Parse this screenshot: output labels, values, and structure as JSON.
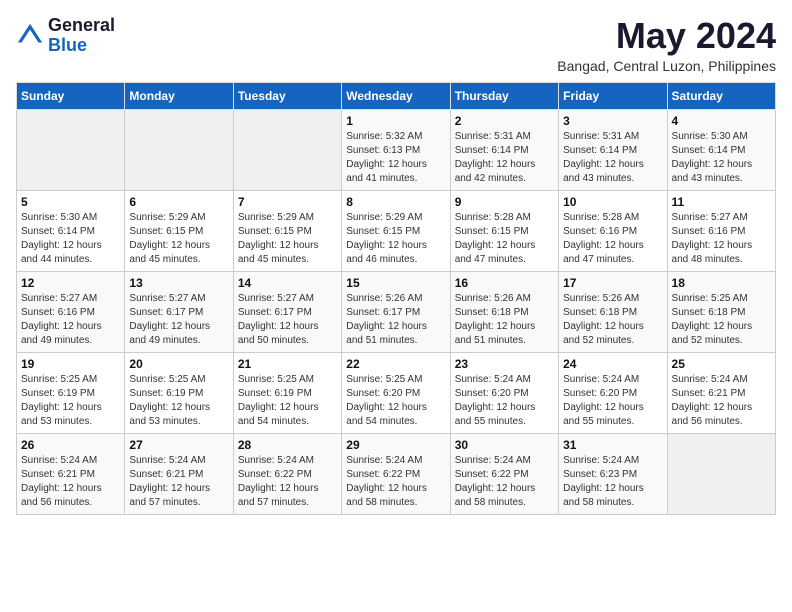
{
  "header": {
    "logo_general": "General",
    "logo_blue": "Blue",
    "month_title": "May 2024",
    "location": "Bangad, Central Luzon, Philippines"
  },
  "weekdays": [
    "Sunday",
    "Monday",
    "Tuesday",
    "Wednesday",
    "Thursday",
    "Friday",
    "Saturday"
  ],
  "weeks": [
    [
      {
        "day": "",
        "sunrise": "",
        "sunset": "",
        "daylight": ""
      },
      {
        "day": "",
        "sunrise": "",
        "sunset": "",
        "daylight": ""
      },
      {
        "day": "",
        "sunrise": "",
        "sunset": "",
        "daylight": ""
      },
      {
        "day": "1",
        "sunrise": "5:32 AM",
        "sunset": "6:13 PM",
        "daylight": "12 hours and 41 minutes."
      },
      {
        "day": "2",
        "sunrise": "5:31 AM",
        "sunset": "6:14 PM",
        "daylight": "12 hours and 42 minutes."
      },
      {
        "day": "3",
        "sunrise": "5:31 AM",
        "sunset": "6:14 PM",
        "daylight": "12 hours and 43 minutes."
      },
      {
        "day": "4",
        "sunrise": "5:30 AM",
        "sunset": "6:14 PM",
        "daylight": "12 hours and 43 minutes."
      }
    ],
    [
      {
        "day": "5",
        "sunrise": "5:30 AM",
        "sunset": "6:14 PM",
        "daylight": "12 hours and 44 minutes."
      },
      {
        "day": "6",
        "sunrise": "5:29 AM",
        "sunset": "6:15 PM",
        "daylight": "12 hours and 45 minutes."
      },
      {
        "day": "7",
        "sunrise": "5:29 AM",
        "sunset": "6:15 PM",
        "daylight": "12 hours and 45 minutes."
      },
      {
        "day": "8",
        "sunrise": "5:29 AM",
        "sunset": "6:15 PM",
        "daylight": "12 hours and 46 minutes."
      },
      {
        "day": "9",
        "sunrise": "5:28 AM",
        "sunset": "6:15 PM",
        "daylight": "12 hours and 47 minutes."
      },
      {
        "day": "10",
        "sunrise": "5:28 AM",
        "sunset": "6:16 PM",
        "daylight": "12 hours and 47 minutes."
      },
      {
        "day": "11",
        "sunrise": "5:27 AM",
        "sunset": "6:16 PM",
        "daylight": "12 hours and 48 minutes."
      }
    ],
    [
      {
        "day": "12",
        "sunrise": "5:27 AM",
        "sunset": "6:16 PM",
        "daylight": "12 hours and 49 minutes."
      },
      {
        "day": "13",
        "sunrise": "5:27 AM",
        "sunset": "6:17 PM",
        "daylight": "12 hours and 49 minutes."
      },
      {
        "day": "14",
        "sunrise": "5:27 AM",
        "sunset": "6:17 PM",
        "daylight": "12 hours and 50 minutes."
      },
      {
        "day": "15",
        "sunrise": "5:26 AM",
        "sunset": "6:17 PM",
        "daylight": "12 hours and 51 minutes."
      },
      {
        "day": "16",
        "sunrise": "5:26 AM",
        "sunset": "6:18 PM",
        "daylight": "12 hours and 51 minutes."
      },
      {
        "day": "17",
        "sunrise": "5:26 AM",
        "sunset": "6:18 PM",
        "daylight": "12 hours and 52 minutes."
      },
      {
        "day": "18",
        "sunrise": "5:25 AM",
        "sunset": "6:18 PM",
        "daylight": "12 hours and 52 minutes."
      }
    ],
    [
      {
        "day": "19",
        "sunrise": "5:25 AM",
        "sunset": "6:19 PM",
        "daylight": "12 hours and 53 minutes."
      },
      {
        "day": "20",
        "sunrise": "5:25 AM",
        "sunset": "6:19 PM",
        "daylight": "12 hours and 53 minutes."
      },
      {
        "day": "21",
        "sunrise": "5:25 AM",
        "sunset": "6:19 PM",
        "daylight": "12 hours and 54 minutes."
      },
      {
        "day": "22",
        "sunrise": "5:25 AM",
        "sunset": "6:20 PM",
        "daylight": "12 hours and 54 minutes."
      },
      {
        "day": "23",
        "sunrise": "5:24 AM",
        "sunset": "6:20 PM",
        "daylight": "12 hours and 55 minutes."
      },
      {
        "day": "24",
        "sunrise": "5:24 AM",
        "sunset": "6:20 PM",
        "daylight": "12 hours and 55 minutes."
      },
      {
        "day": "25",
        "sunrise": "5:24 AM",
        "sunset": "6:21 PM",
        "daylight": "12 hours and 56 minutes."
      }
    ],
    [
      {
        "day": "26",
        "sunrise": "5:24 AM",
        "sunset": "6:21 PM",
        "daylight": "12 hours and 56 minutes."
      },
      {
        "day": "27",
        "sunrise": "5:24 AM",
        "sunset": "6:21 PM",
        "daylight": "12 hours and 57 minutes."
      },
      {
        "day": "28",
        "sunrise": "5:24 AM",
        "sunset": "6:22 PM",
        "daylight": "12 hours and 57 minutes."
      },
      {
        "day": "29",
        "sunrise": "5:24 AM",
        "sunset": "6:22 PM",
        "daylight": "12 hours and 58 minutes."
      },
      {
        "day": "30",
        "sunrise": "5:24 AM",
        "sunset": "6:22 PM",
        "daylight": "12 hours and 58 minutes."
      },
      {
        "day": "31",
        "sunrise": "5:24 AM",
        "sunset": "6:23 PM",
        "daylight": "12 hours and 58 minutes."
      },
      {
        "day": "",
        "sunrise": "",
        "sunset": "",
        "daylight": ""
      }
    ]
  ]
}
